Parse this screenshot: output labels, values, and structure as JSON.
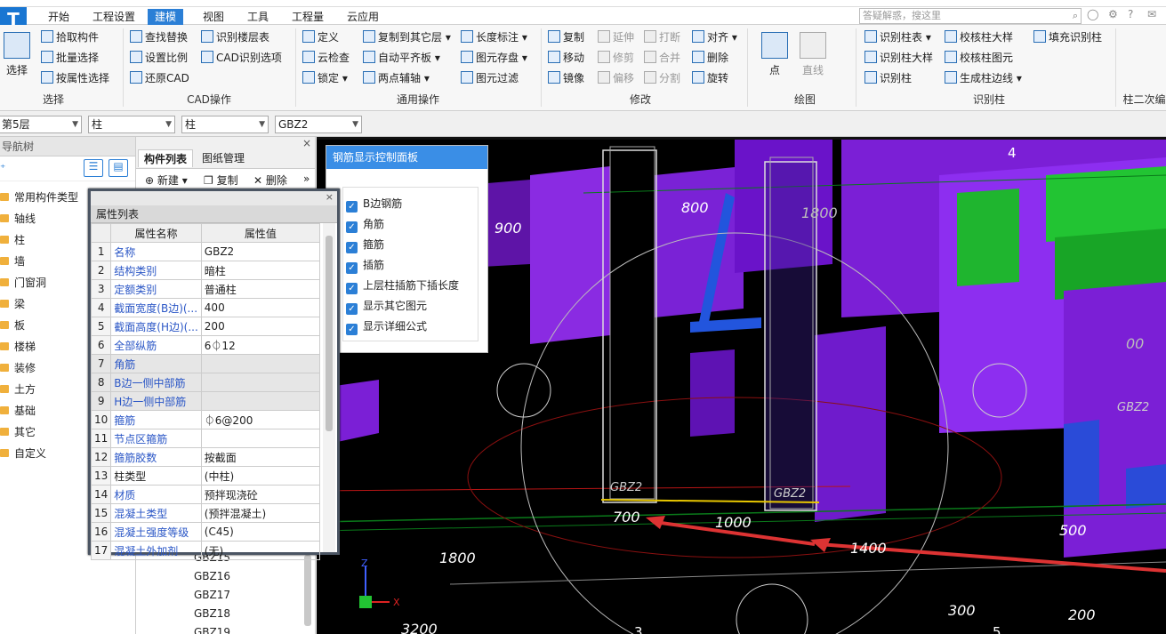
{
  "app": {
    "logo": "T"
  },
  "menu": [
    "开始",
    "工程设置",
    "建模",
    "视图",
    "工具",
    "工程量",
    "云应用"
  ],
  "search": {
    "placeholder": "答疑解惑，搜这里"
  },
  "ribbon": {
    "select": {
      "big": "选择",
      "items": [
        "拾取构件",
        "批量选择",
        "按属性选择"
      ],
      "label": "选择"
    },
    "cad": {
      "items": [
        "查找替换",
        "识别楼层表",
        "设置比例",
        "CAD识别选项",
        "还原CAD"
      ],
      "label": "CAD操作"
    },
    "common": {
      "items": [
        "定义",
        "复制到其它层",
        "长度标注",
        "云检查",
        "自动平齐板",
        "图元存盘",
        "锁定",
        "两点辅轴",
        "图元过滤"
      ],
      "label": "通用操作"
    },
    "modify": {
      "items": [
        "复制",
        "延伸",
        "打断",
        "对齐",
        "移动",
        "修剪",
        "合并",
        "删除",
        "镜像",
        "偏移",
        "分割",
        "旋转"
      ],
      "label": "修改"
    },
    "draw": {
      "items": [
        "点",
        "直线"
      ],
      "label": "绘图"
    },
    "recognize": {
      "items": [
        "识别柱表",
        "校核柱大样",
        "填充识别柱",
        "识别柱大样",
        "校核柱图元",
        "识别柱",
        "生成柱边线"
      ],
      "label": "识别柱"
    },
    "extra_label": "柱二次编"
  },
  "selectors": {
    "floor": "第5层",
    "type1": "柱",
    "type2": "柱",
    "name": "GBZ2"
  },
  "navtree": {
    "header": "导航树",
    "items": [
      "常用构件类型",
      "轴线",
      "柱",
      "墙",
      "门窗洞",
      "梁",
      "板",
      "楼梯",
      "装修",
      "土方",
      "基础",
      "其它",
      "自定义"
    ]
  },
  "complist": {
    "tabs": [
      "构件列表",
      "图纸管理"
    ],
    "tools": [
      "新建",
      "复制",
      "删除"
    ],
    "items": [
      "GBZ15",
      "GBZ16",
      "GBZ17",
      "GBZ18",
      "GBZ19"
    ]
  },
  "props": {
    "title": "属性列表",
    "col_name": "属性名称",
    "col_value": "属性值",
    "rows": [
      {
        "n": "1",
        "name": "名称",
        "value": "GBZ2"
      },
      {
        "n": "2",
        "name": "结构类别",
        "value": "暗柱"
      },
      {
        "n": "3",
        "name": "定额类别",
        "value": "普通柱"
      },
      {
        "n": "4",
        "name": "截面宽度(B边)(...",
        "value": "400"
      },
      {
        "n": "5",
        "name": "截面高度(H边)(...",
        "value": "200"
      },
      {
        "n": "6",
        "name": "全部纵筋",
        "value": "6⏀12"
      },
      {
        "n": "7",
        "name": "角筋",
        "value": ""
      },
      {
        "n": "8",
        "name": "B边一侧中部筋",
        "value": ""
      },
      {
        "n": "9",
        "name": "H边一侧中部筋",
        "value": ""
      },
      {
        "n": "10",
        "name": "箍筋",
        "value": "⏀6@200"
      },
      {
        "n": "11",
        "name": "节点区箍筋",
        "value": ""
      },
      {
        "n": "12",
        "name": "箍筋胶数",
        "value": "按截面"
      },
      {
        "n": "13",
        "name": "柱类型",
        "value": "(中柱)"
      },
      {
        "n": "14",
        "name": "材质",
        "value": "预拌现浇砼"
      },
      {
        "n": "15",
        "name": "混凝土类型",
        "value": "(预拌混凝土)"
      },
      {
        "n": "16",
        "name": "混凝土强度等级",
        "value": "(C45)"
      },
      {
        "n": "17",
        "name": "混凝土外加剂",
        "value": "(无)"
      }
    ]
  },
  "rebar_panel": {
    "title": "钢筋显示控制面板",
    "options": [
      "B边钢筋",
      "角筋",
      "箍筋",
      "插筋",
      "上层柱插筋下插长度",
      "显示其它图元",
      "显示详细公式"
    ]
  },
  "viewport": {
    "dims": [
      "800",
      "1800",
      "900",
      "700",
      "1000",
      "1800",
      "1400",
      "500",
      "300",
      "200",
      "3200",
      "00"
    ],
    "col_labels": [
      "GBZ2",
      "GBZ2",
      "GBZ2"
    ],
    "axis_nums": [
      "4",
      "3",
      "5"
    ]
  }
}
